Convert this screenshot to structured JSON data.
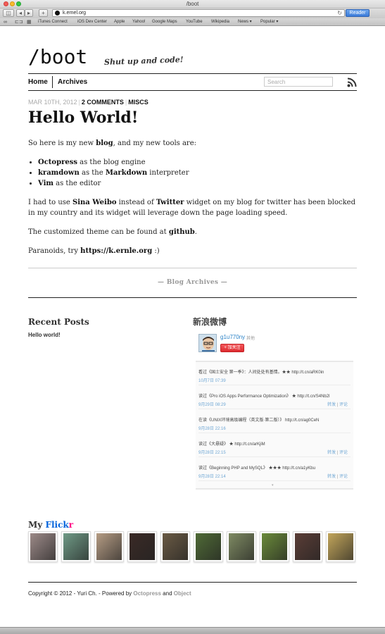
{
  "window": {
    "title": "/boot"
  },
  "browser": {
    "url": "k.ernel.org",
    "reader_label": "Reader",
    "bookmarks": [
      "iTunes Connect",
      "iOS Dev Center",
      "Apple",
      "Yahoo!",
      "Google Maps",
      "YouTube",
      "Wikipedia",
      "News ▾",
      "Popular ▾"
    ]
  },
  "site": {
    "title": "/boot",
    "subtitle": "Shut up and code!",
    "nav": {
      "home": "Home",
      "archives": "Archives"
    },
    "search_placeholder": "Search"
  },
  "post": {
    "date": "MAR 10TH, 2012",
    "comments": "2 COMMENTS",
    "category": "MISCS",
    "title": "Hello World!",
    "p1_pre": "So here is my new ",
    "p1_b": "blog",
    "p1_post": ", and my new tools are:",
    "list": [
      {
        "b": "Octopress",
        "t": " as the blog engine"
      },
      {
        "b": "kramdown",
        "t": " as the ",
        "b2": "Markdown",
        "t2": " interpreter"
      },
      {
        "b": "Vim",
        "t": " as the editor"
      }
    ],
    "p2_a": "I had to use ",
    "p2_b1": "Sina Weibo",
    "p2_c": " instead of ",
    "p2_b2": "Twitter",
    "p2_d": " widget on my blog for twitter has been blocked in my country and its widget will leverage down the page loading speed.",
    "p3_a": "The customized theme can be found at ",
    "p3_b": "github",
    "p3_c": ".",
    "p4_a": "Paranoids, try ",
    "p4_b": "https://k.ernle.org",
    "p4_c": " :)"
  },
  "archives_link": "— Blog Archives —",
  "sidebar": {
    "recent_title": "Recent Posts",
    "recent_posts": [
      "Hello world!"
    ],
    "weibo_title": "新浪微博",
    "weibo_user": "g1u770ny",
    "weibo_other": "其他",
    "follow_label": "+ 加关注",
    "feed": [
      {
        "text": "看过《国土安全 第一季》：人间处处有基情。★★ http://t.cn/aRK0in",
        "time": "10月7日 07:39"
      },
      {
        "text": "读过《Pro iOS Apps Performance Optimization》 ★ http://t.cn/S4Nb2l",
        "time": "9月29日 08:29"
      },
      {
        "text": "在读《UNIX环境高级编程（英文版·第二版）》 http://t.cn/ag0CeN",
        "time": "9月28日 22:16"
      },
      {
        "text": "读过《大悬疑》 ★ http://t.cn/arKjiM",
        "time": "9月28日 22:15"
      },
      {
        "text": "读过《Beginning PHP and MySQL》 ★★★ http://t.cn/a1yKbu",
        "time": "9月28日 22:14"
      }
    ],
    "feed_action_1": "转发",
    "feed_action_2": "评论",
    "flickr_title_pre": "My ",
    "flickr_title_fl1": "Flick",
    "flickr_title_fl2": "r",
    "flickr_colors": [
      "#9c8a88",
      "#6f9a86",
      "#b59c84",
      "#3a2a26",
      "#6a5a44",
      "#4f6a36",
      "#7e8a62",
      "#6a8a3a",
      "#5a3d36",
      "#c2a55a"
    ]
  },
  "footer": {
    "text_pre": "Copyright © 2012 - Yuri Ch. - Powered by ",
    "link1": "Octopress",
    "text_mid": " and ",
    "link2": "Object"
  }
}
